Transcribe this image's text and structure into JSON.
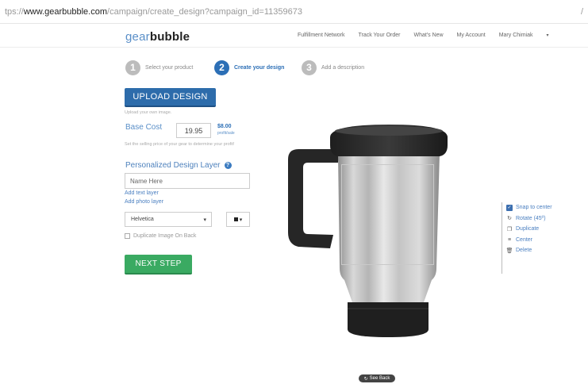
{
  "browser": {
    "url_prefix": "tps://",
    "url_host": "www.gearbubble.com",
    "url_path": "/campaign/create_design?campaign_id=11359673",
    "url_end": "/"
  },
  "header": {
    "logo_part1": "gear",
    "logo_part2": "bubble",
    "nav": {
      "fulfillment": "Fulfillment Network",
      "track": "Track Your Order",
      "whats_new": "What's New",
      "account": "My Account",
      "user": "Mary Chimiak",
      "caret": "▾"
    }
  },
  "steps": [
    {
      "number": "1",
      "label": "Select your product"
    },
    {
      "number": "2",
      "label": "Create your design"
    },
    {
      "number": "3",
      "label": "Add a description"
    }
  ],
  "form": {
    "upload_label": "UPLOAD DESIGN",
    "upload_note": "Upload your own image.",
    "base_cost_label": "Base Cost",
    "base_cost_value": "19.95",
    "profit_value": "$8.00",
    "profit_unit": "profit/sale",
    "price_note": "Set the selling price of your gear to determine your profit!",
    "layer_title": "Personalized Design Layer",
    "help_icon_glyph": "?",
    "name_value": "Name Here",
    "add_text_layer": "Add text layer",
    "add_photo_layer": "Add photo layer",
    "font_value": "Helvetica",
    "select_caret": "▾",
    "duplicate_label": "Duplicate Image On Back",
    "next_label": "NEXT STEP"
  },
  "tools": [
    {
      "icon": "checkbox-icon",
      "glyph": "✓",
      "label": "Snap to center"
    },
    {
      "icon": "rotate-icon",
      "glyph": "↻",
      "label": "Rotate (45º)"
    },
    {
      "icon": "duplicate-icon",
      "glyph": "❐",
      "label": "Duplicate"
    },
    {
      "icon": "center-icon",
      "glyph": "≡",
      "label": "Center"
    },
    {
      "icon": "delete-icon",
      "glyph": "🗑",
      "label": "Delete"
    }
  ],
  "see_back": "See Back",
  "see_back_glyph": "↻",
  "colors": {
    "brand_blue": "#2d6cab",
    "next_green": "#3aaa62",
    "link_blue": "#4a7fc0"
  }
}
